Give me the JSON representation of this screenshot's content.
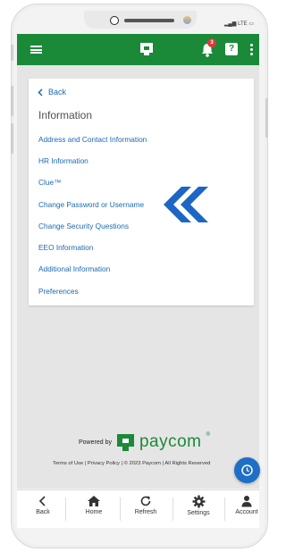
{
  "statusbar": {
    "right_text": "LTE"
  },
  "appbar": {
    "notification_count": "3",
    "help_label": "?"
  },
  "card": {
    "back_label": "Back",
    "title": "Information",
    "links": [
      "Address and Contact Information",
      "HR Information",
      "Clue™",
      "Change Password or Username",
      "Change Security Questions",
      "EEO Information",
      "Additional Information",
      "Preferences"
    ]
  },
  "branding": {
    "powered_by": "Powered by",
    "wordmark": "paycom",
    "registered": "®"
  },
  "footer": {
    "text": "Terms of Use | Privacy Policy | © 2023 Paycom | All Rights Reserved"
  },
  "bottom_nav": [
    {
      "label": "Back",
      "icon": "chevron-left-icon"
    },
    {
      "label": "Home",
      "icon": "home-icon"
    },
    {
      "label": "Refresh",
      "icon": "refresh-icon"
    },
    {
      "label": "Settings",
      "icon": "gear-icon"
    },
    {
      "label": "Account",
      "icon": "person-icon"
    }
  ],
  "colors": {
    "brand_green": "#1a8a38",
    "link_blue": "#1c68b2",
    "fab_blue": "#1f6ec8",
    "chevron_blue": "#1d66c4"
  }
}
